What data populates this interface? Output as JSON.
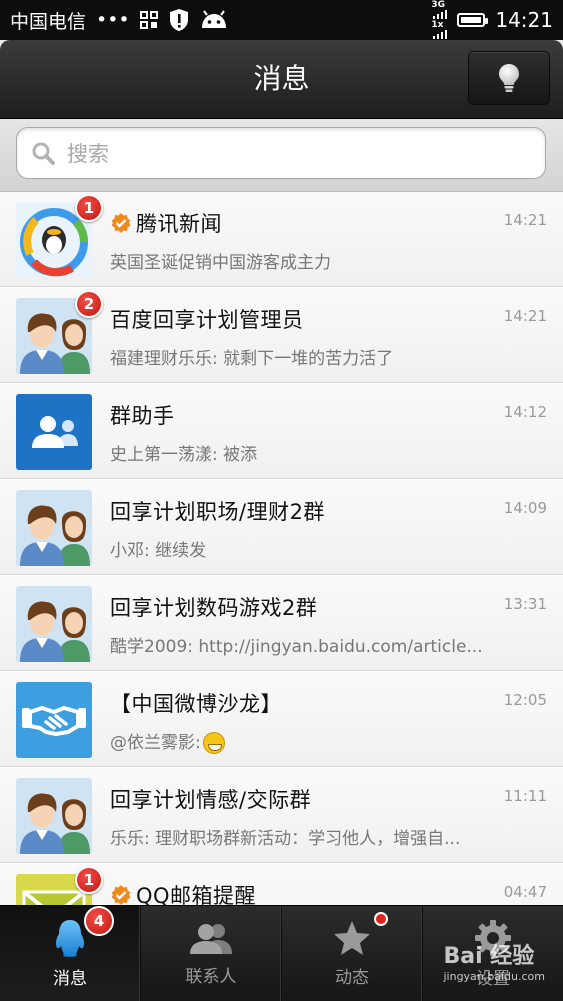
{
  "status_bar": {
    "carrier": "中国电信",
    "dots": "•••",
    "network_top": "3G",
    "network_bottom": "1x",
    "time": "14:21"
  },
  "header": {
    "title": "消息"
  },
  "search": {
    "placeholder": "搜索"
  },
  "messages": [
    {
      "name": "腾讯新闻",
      "time": "14:21",
      "preview": "英国圣诞促销中国游客成主力",
      "badge": "1",
      "verified": true,
      "avatar": "tencent-news-icon"
    },
    {
      "name": "百度回享计划管理员",
      "time": "14:21",
      "preview": "福建理财乐乐: 就剩下一堆的苦力活了",
      "badge": "2",
      "verified": false,
      "avatar": "default-couple-avatar"
    },
    {
      "name": "群助手",
      "time": "14:12",
      "preview": "史上第一荡漾: 被添",
      "badge": "",
      "verified": false,
      "avatar": "group-assistant-icon"
    },
    {
      "name": "回享计划职场/理财2群",
      "time": "14:09",
      "preview": "小邓: 继续发",
      "badge": "",
      "verified": false,
      "avatar": "default-couple-avatar"
    },
    {
      "name": "回享计划数码游戏2群",
      "time": "13:31",
      "preview": "酷学2009: http://jingyan.baidu.com/article...",
      "badge": "",
      "verified": false,
      "avatar": "default-couple-avatar"
    },
    {
      "name": "【中国微博沙龙】",
      "time": "12:05",
      "preview": "@依兰雾影:",
      "badge": "",
      "verified": false,
      "avatar": "handshake-icon"
    },
    {
      "name": "回享计划情感/交际群",
      "time": "11:11",
      "preview": "乐乐: 理财职场群新活动：学习他人，增强自...",
      "badge": "",
      "verified": false,
      "avatar": "default-couple-avatar"
    },
    {
      "name": "QQ邮箱提醒",
      "time": "04:47",
      "preview": "",
      "badge": "1",
      "verified": true,
      "avatar": "mail-icon"
    }
  ],
  "tabs": [
    {
      "label": "消息",
      "badge": "4",
      "active": true,
      "icon": "qq-penguin-icon"
    },
    {
      "label": "联系人",
      "badge": "",
      "active": false,
      "icon": "contacts-icon"
    },
    {
      "label": "动态",
      "badge": "dot",
      "active": false,
      "icon": "star-icon"
    },
    {
      "label": "设置",
      "badge": "",
      "active": false,
      "icon": "gear-icon"
    }
  ],
  "watermark": {
    "brand": "Bai 经验",
    "url": "jingyan.baidu.com"
  },
  "colors": {
    "badge_red": "#d21f19",
    "verified_orange": "#f08a1c",
    "header_dark": "#2a2a2a"
  }
}
